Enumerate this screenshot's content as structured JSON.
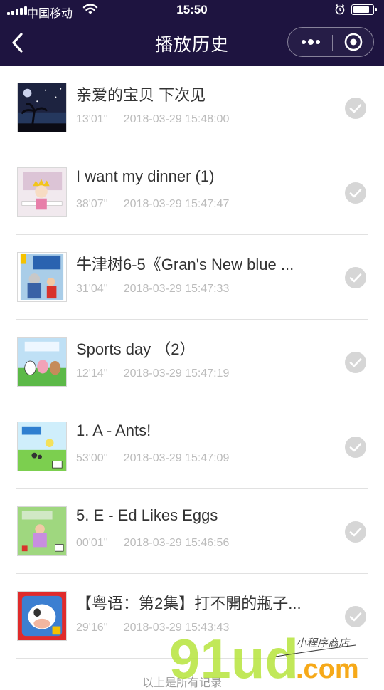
{
  "status": {
    "carrier": "中国移动",
    "time": "15:50"
  },
  "nav": {
    "title": "播放历史",
    "back_icon": "chevron-left-icon",
    "more_icon": "more-dots-icon",
    "close_icon": "target-close-icon"
  },
  "history": [
    {
      "title": "亲爱的宝贝 下次见",
      "duration": "13'01''",
      "time": "2018-03-29 15:48:00",
      "thumb": "night-palm"
    },
    {
      "title": "I want my dinner (1)",
      "duration": "38'07''",
      "time": "2018-03-29 15:47:47",
      "thumb": "princess"
    },
    {
      "title": "牛津树6-5《Gran's New blue ...",
      "duration": "31'04''",
      "time": "2018-03-29 15:47:33",
      "thumb": "gran-shoes"
    },
    {
      "title": "Sports day （2）",
      "duration": "12'14''",
      "time": "2018-03-29 15:47:19",
      "thumb": "sports"
    },
    {
      "title": "1. A - Ants!",
      "duration": "53'00''",
      "time": "2018-03-29 15:47:09",
      "thumb": "ants"
    },
    {
      "title": "5. E - Ed Likes Eggs",
      "duration": "00'01''",
      "time": "2018-03-29 15:46:56",
      "thumb": "eggs"
    },
    {
      "title": "【粤语：第2集】打不開的瓶子...",
      "duration": "29'16''",
      "time": "2018-03-29 15:43:43",
      "thumb": "cow"
    }
  ],
  "footer_text": "以上是所有记录",
  "watermark": {
    "brand": "91ud",
    "domain": ".com",
    "tagline": "小程序商店"
  }
}
